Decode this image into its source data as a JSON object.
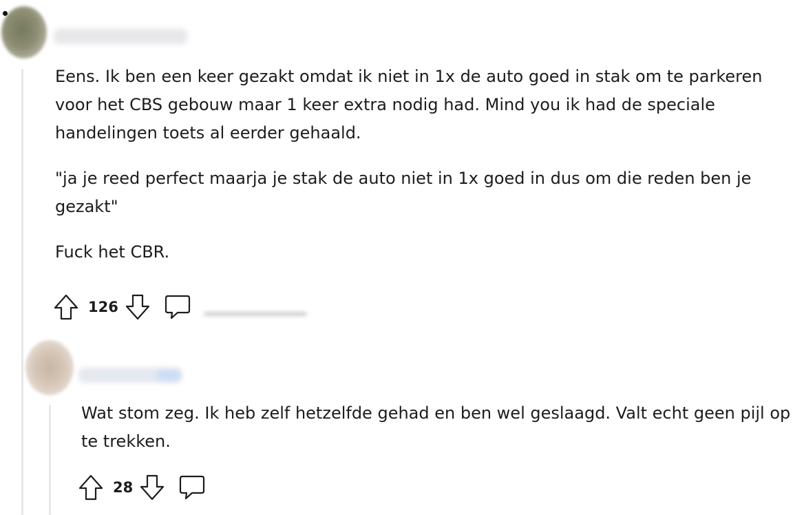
{
  "comments": [
    {
      "paragraphs": [
        "Eens. Ik ben een keer gezakt omdat ik niet in 1x de auto goed in stak om te parkeren voor het CBS gebouw maar 1 keer extra nodig had. Mind you ik had de speciale handelingen toets al eerder gehaald.",
        "\"ja je reed perfect maarja je stak de auto niet in 1x goed in dus om die reden ben je gezakt\"",
        "Fuck het CBR."
      ],
      "score": "126"
    },
    {
      "paragraphs": [
        "Wat stom zeg. Ik heb zelf hetzelfde gehad en ben wel geslaagd. Valt echt geen pijl op te trekken."
      ],
      "score": "28"
    }
  ],
  "icons": {
    "upvote": "arrow-up-outline-icon",
    "downvote": "arrow-down-outline-icon",
    "reply": "speech-bubble-icon"
  },
  "colors": {
    "text": "#1c1c1c",
    "icon": "#1c1c1c",
    "thread_line": "#e7e7e7"
  }
}
